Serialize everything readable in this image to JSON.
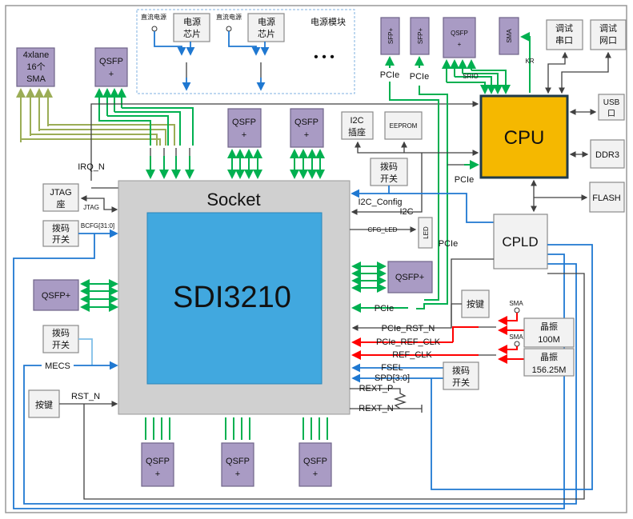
{
  "colors": {
    "cpu": "#F5B800",
    "socket": "#D0D0D0",
    "chip": "#41A8DF",
    "module": "#A99BC4",
    "pcie": "#00B050",
    "power": "#1F78D1",
    "clock": "#FF0000",
    "sma_lines": "#9BAD56"
  },
  "power": {
    "title": "电源模块",
    "dc1": "直流电源",
    "dc2": "直流电源",
    "chip1": [
      "电源",
      "芯片"
    ],
    "chip2": [
      "电源",
      "芯片"
    ],
    "more": "• • •"
  },
  "left": {
    "sma": [
      "4xlane",
      "16个",
      "SMA"
    ],
    "qsfp_top": [
      "QSFP",
      "+"
    ],
    "irq": "IRQ_N",
    "jtag": [
      "JTAG",
      "座"
    ],
    "jtag_label": "JTAG",
    "dip1": [
      "拨码",
      "开关"
    ],
    "bcfg": "BCFG[31:0]",
    "qsfp_left": "QSFP+",
    "dip2": [
      "拨码",
      "开关"
    ],
    "mecs": "MECS",
    "key": "按键",
    "rst": "RST_N"
  },
  "mid": {
    "qsfp1": [
      "QSFP",
      "+"
    ],
    "qsfp2": [
      "QSFP",
      "+"
    ],
    "socket": "Socket",
    "chip": "SDI3210",
    "bottom_qsfp": [
      [
        "QSFP",
        "+"
      ],
      [
        "QSFP",
        "+"
      ],
      [
        "QSFP",
        "+"
      ]
    ]
  },
  "right": {
    "sfp1": "SFP+",
    "sfp2": "SFP+",
    "qsfp": [
      "QSFP",
      "+"
    ],
    "sma": "SMA",
    "serial": [
      "调试",
      "串口"
    ],
    "net": [
      "调试",
      "网口"
    ],
    "pcie1": "PCIe",
    "pcie2": "PCIe",
    "srio": "SRIO",
    "kr": "KR",
    "cpu": "CPU",
    "usb": [
      "USB",
      "口"
    ],
    "ddr3": "DDR3",
    "flash": "FLASH",
    "i2c_socket": [
      "I2C",
      "插座"
    ],
    "eeprom": "EEPROM",
    "dip": [
      "拨码",
      "开关"
    ],
    "pcie3": "PCIe",
    "i2c_config": "I2C_Config",
    "i2c": "I2C",
    "cfg_led": "CFG_LED",
    "led": "LED",
    "pcie4": "PCIe",
    "cpld": "CPLD",
    "qsfp_right": "QSFP+",
    "pcie5": "PCIe",
    "key": "按键",
    "pcie_rst": "PCIe_RST_N",
    "pcie_ref_clk": "PCIe_REF_CLK",
    "ref_clk": "REF_CLK",
    "fsel": "FSEL",
    "spd": "SPD[3:0]",
    "rext_p": "REXT_P",
    "rext_n": "REXT_N",
    "sma1": "SMA",
    "sma2": "SMA",
    "osc1": [
      "晶振",
      "100M"
    ],
    "osc2": [
      "晶振",
      "156.25M"
    ],
    "dip2": [
      "拨码",
      "开关"
    ]
  }
}
